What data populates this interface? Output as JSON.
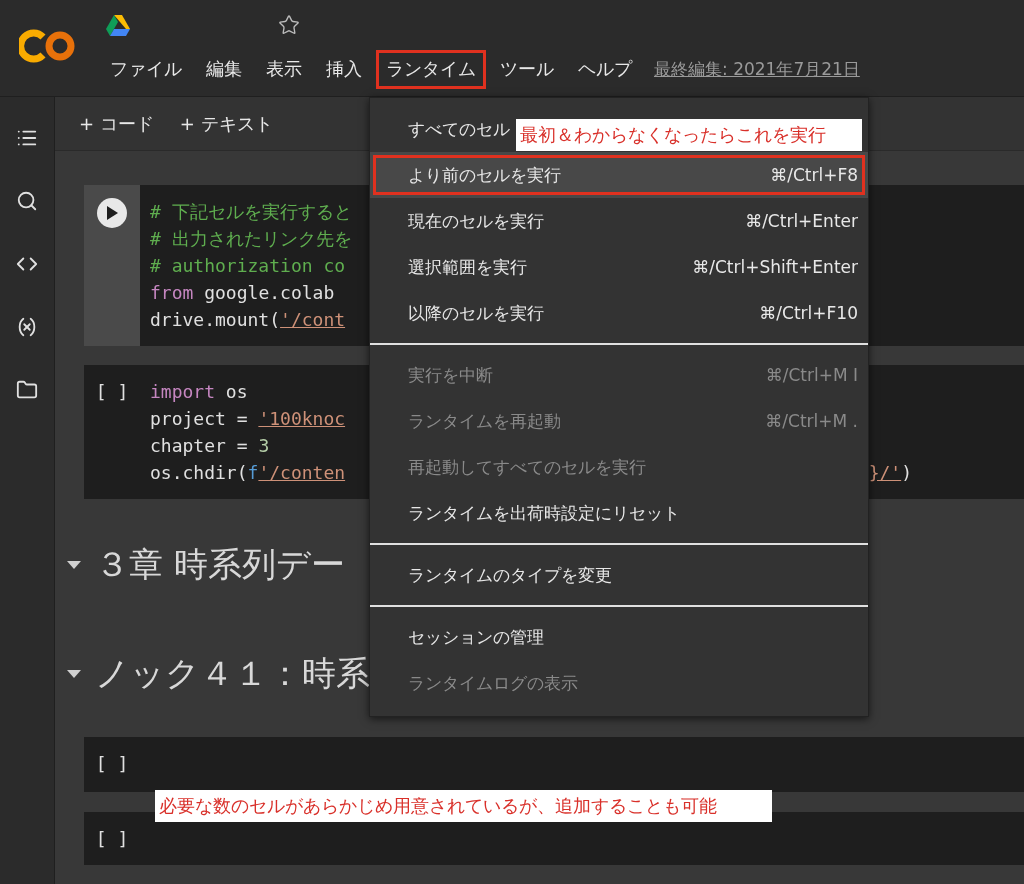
{
  "header": {
    "menu": [
      {
        "label": "ファイル",
        "selected": false
      },
      {
        "label": "編集",
        "selected": false
      },
      {
        "label": "表示",
        "selected": false
      },
      {
        "label": "挿入",
        "selected": false
      },
      {
        "label": "ランタイム",
        "selected": true
      },
      {
        "label": "ツール",
        "selected": false
      },
      {
        "label": "ヘルプ",
        "selected": false
      }
    ],
    "last_edit": "最終編集: 2021年7月21日"
  },
  "toolbar": {
    "buttons": [
      "+ コード",
      "+ テキスト"
    ]
  },
  "cells": [
    {
      "kind": "code",
      "running": false,
      "lines": [
        {
          "tokens": [
            {
              "kind": "comment",
              "s": "# 下記セルを実行すると"
            }
          ]
        },
        {
          "tokens": [
            {
              "kind": "comment",
              "s": "# 出力されたリンク先を"
            }
          ]
        },
        {
          "tokens": [
            {
              "kind": "comment",
              "s": "# authorization co"
            }
          ]
        },
        {
          "tokens": [
            {
              "kind": "keyword",
              "s": "from"
            },
            {
              "kind": "plain",
              "s": " google.colab"
            }
          ]
        },
        {
          "tokens": [
            {
              "kind": "plain",
              "s": "drive.mount("
            },
            {
              "kind": "string",
              "s": "'/cont"
            }
          ]
        }
      ]
    },
    {
      "kind": "code",
      "prompt": "[ ]",
      "lines": [
        {
          "tokens": [
            {
              "kind": "keyword",
              "s": "import"
            },
            {
              "kind": "plain",
              "s": " os"
            }
          ]
        },
        {
          "tokens": [
            {
              "kind": "plain",
              "s": "project = "
            },
            {
              "kind": "string",
              "s": "'100knoc"
            }
          ]
        },
        {
          "tokens": [
            {
              "kind": "plain",
              "s": "chapter = "
            },
            {
              "kind": "number",
              "s": "3"
            }
          ]
        },
        {
          "tokens": [
            {
              "kind": "plain",
              "s": "os.chdir("
            },
            {
              "kind": "fprefix",
              "s": "f"
            },
            {
              "kind": "string",
              "s": "'/conten"
            }
          ],
          "tail": [
            {
              "kind": "string",
              "s": "}/'"
            },
            {
              "kind": "plain",
              "s": ")"
            }
          ]
        }
      ]
    },
    {
      "kind": "heading",
      "text": "３章 時系列デー",
      "expanded": true
    },
    {
      "kind": "heading",
      "text": "ノック４１：時系",
      "expanded": true
    },
    {
      "kind": "code",
      "prompt": "[ ]"
    },
    {
      "kind": "code",
      "prompt": "[ ]"
    }
  ],
  "runtime_menu": [
    {
      "kind": "item",
      "label": "すべてのセル",
      "disabled": false,
      "selected": false
    },
    {
      "kind": "item",
      "label": "より前のセルを実行",
      "shortcut": "⌘/Ctrl+F8",
      "disabled": false,
      "selected": true
    },
    {
      "kind": "item",
      "label": "現在のセルを実行",
      "shortcut": "⌘/Ctrl+Enter",
      "disabled": false,
      "selected": false
    },
    {
      "kind": "item",
      "label": "選択範囲を実行",
      "shortcut": "⌘/Ctrl+Shift+Enter",
      "disabled": false,
      "selected": false
    },
    {
      "kind": "item",
      "label": "以降のセルを実行",
      "shortcut": "⌘/Ctrl+F10",
      "disabled": false,
      "selected": false
    },
    {
      "kind": "divider"
    },
    {
      "kind": "item",
      "label": "実行を中断",
      "shortcut": "⌘/Ctrl+M I",
      "disabled": true,
      "selected": false
    },
    {
      "kind": "item",
      "label": "ランタイムを再起動",
      "shortcut": "⌘/Ctrl+M .",
      "disabled": true,
      "selected": false
    },
    {
      "kind": "item",
      "label": "再起動してすべてのセルを実行",
      "disabled": true,
      "selected": false
    },
    {
      "kind": "item",
      "label": "ランタイムを出荷時設定にリセット",
      "disabled": false,
      "selected": false
    },
    {
      "kind": "divider"
    },
    {
      "kind": "item",
      "label": "ランタイムのタイプを変更",
      "disabled": false,
      "selected": false
    },
    {
      "kind": "divider"
    },
    {
      "kind": "item",
      "label": "セッションの管理",
      "disabled": false,
      "selected": false
    },
    {
      "kind": "item",
      "label": "ランタイムログの表示",
      "disabled": true,
      "selected": false
    }
  ],
  "annotations": [
    {
      "text": "最初＆わからなくなったらこれを実行"
    },
    {
      "text": "必要な数のセルがあらかじめ用意されているが、追加することも可能"
    }
  ]
}
